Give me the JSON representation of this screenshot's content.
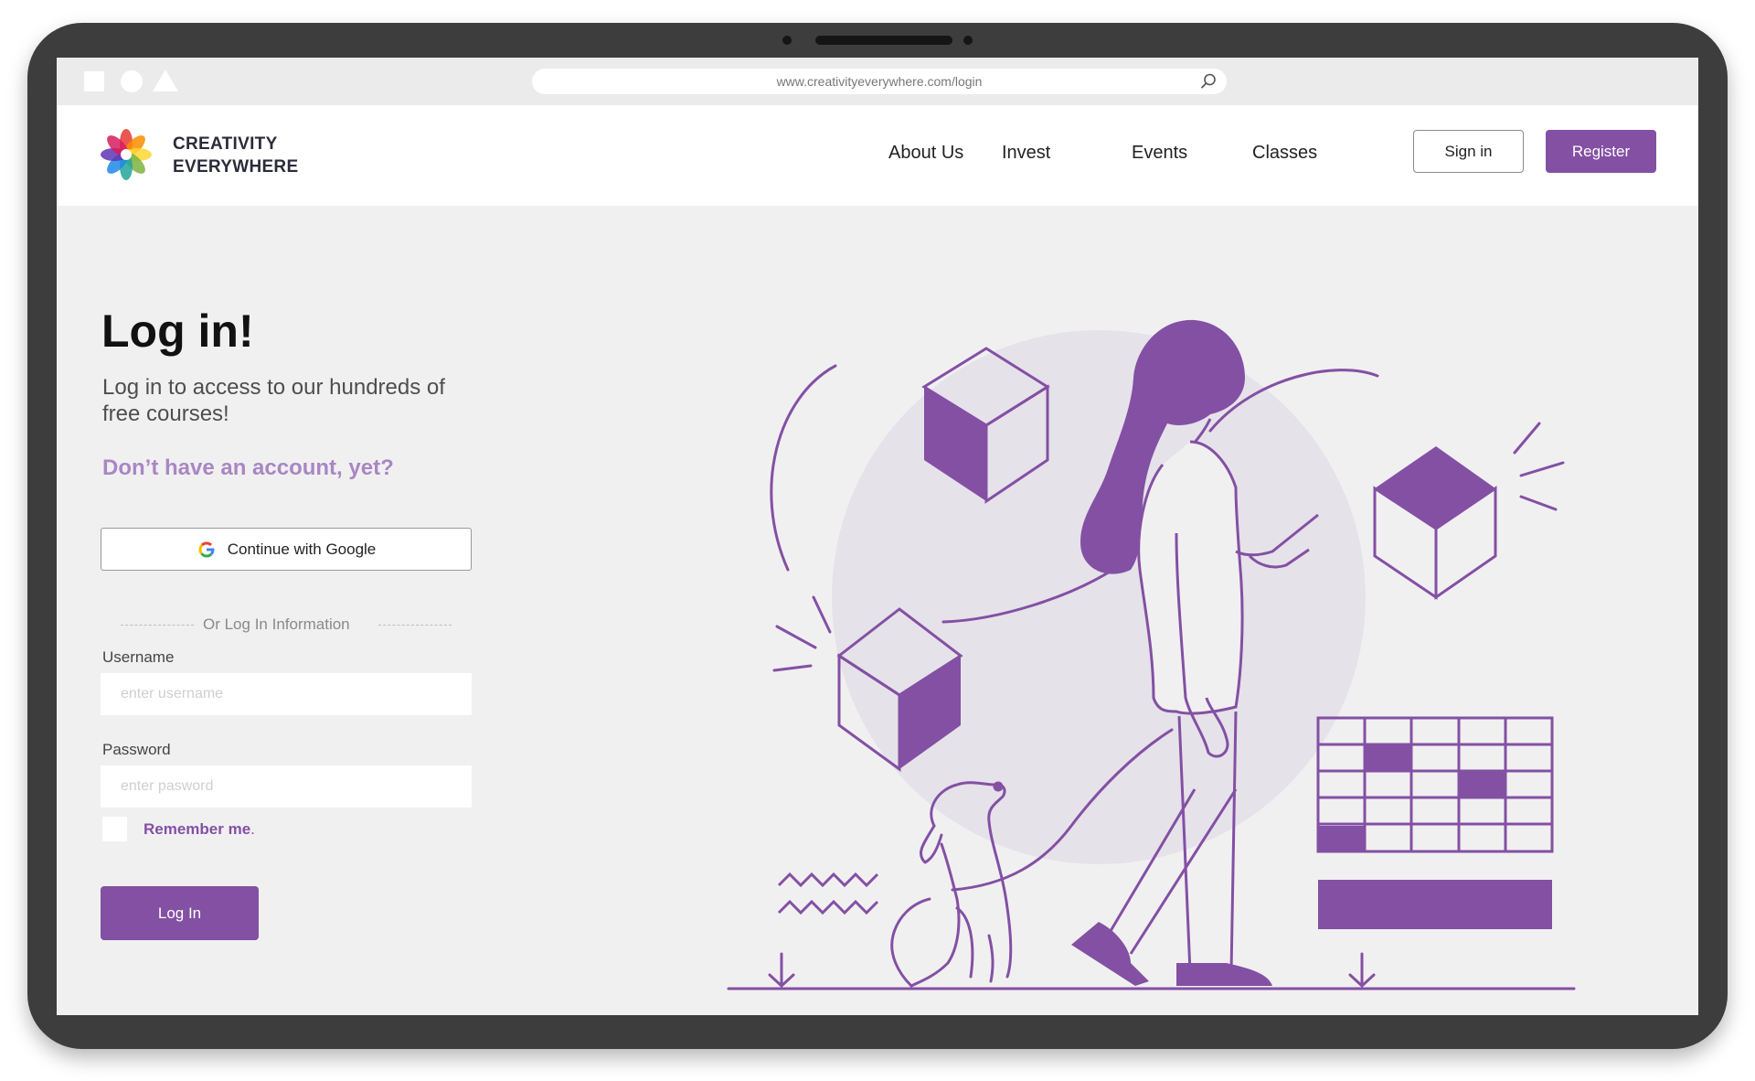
{
  "browser": {
    "url": "www.creativityeverywhere.com/login",
    "window_shapes": [
      "square-icon",
      "circle-icon",
      "triangle-icon"
    ],
    "search_icon": "search-icon"
  },
  "header": {
    "brand_line1": "CREATIVITY",
    "brand_line2": "EVERYWHERE",
    "logo_icon": "flower-logo",
    "nav": [
      "About Us",
      "Invest",
      "Events",
      "Classes"
    ],
    "signin_label": "Sign in",
    "register_label": "Register"
  },
  "login": {
    "title": "Log in!",
    "subtitle": "Log in to access to our hundreds of free courses!",
    "signup_prompt": "Don’t have an account, yet?",
    "google_label": "Continue with Google",
    "divider_text": "Or Log In Information",
    "username_label": "Username",
    "username_placeholder": "enter username",
    "username_value": "",
    "password_label": "Password",
    "password_placeholder": "enter pasword",
    "password_value": "",
    "remember_label": "Remember me",
    "remember_suffix": ".",
    "remember_checked": false,
    "submit_label": "Log In"
  },
  "colors": {
    "accent": "#8350a4",
    "accent_light": "#a887c3",
    "background": "#f1f0f1",
    "device_frame": "#3d3d3d"
  }
}
